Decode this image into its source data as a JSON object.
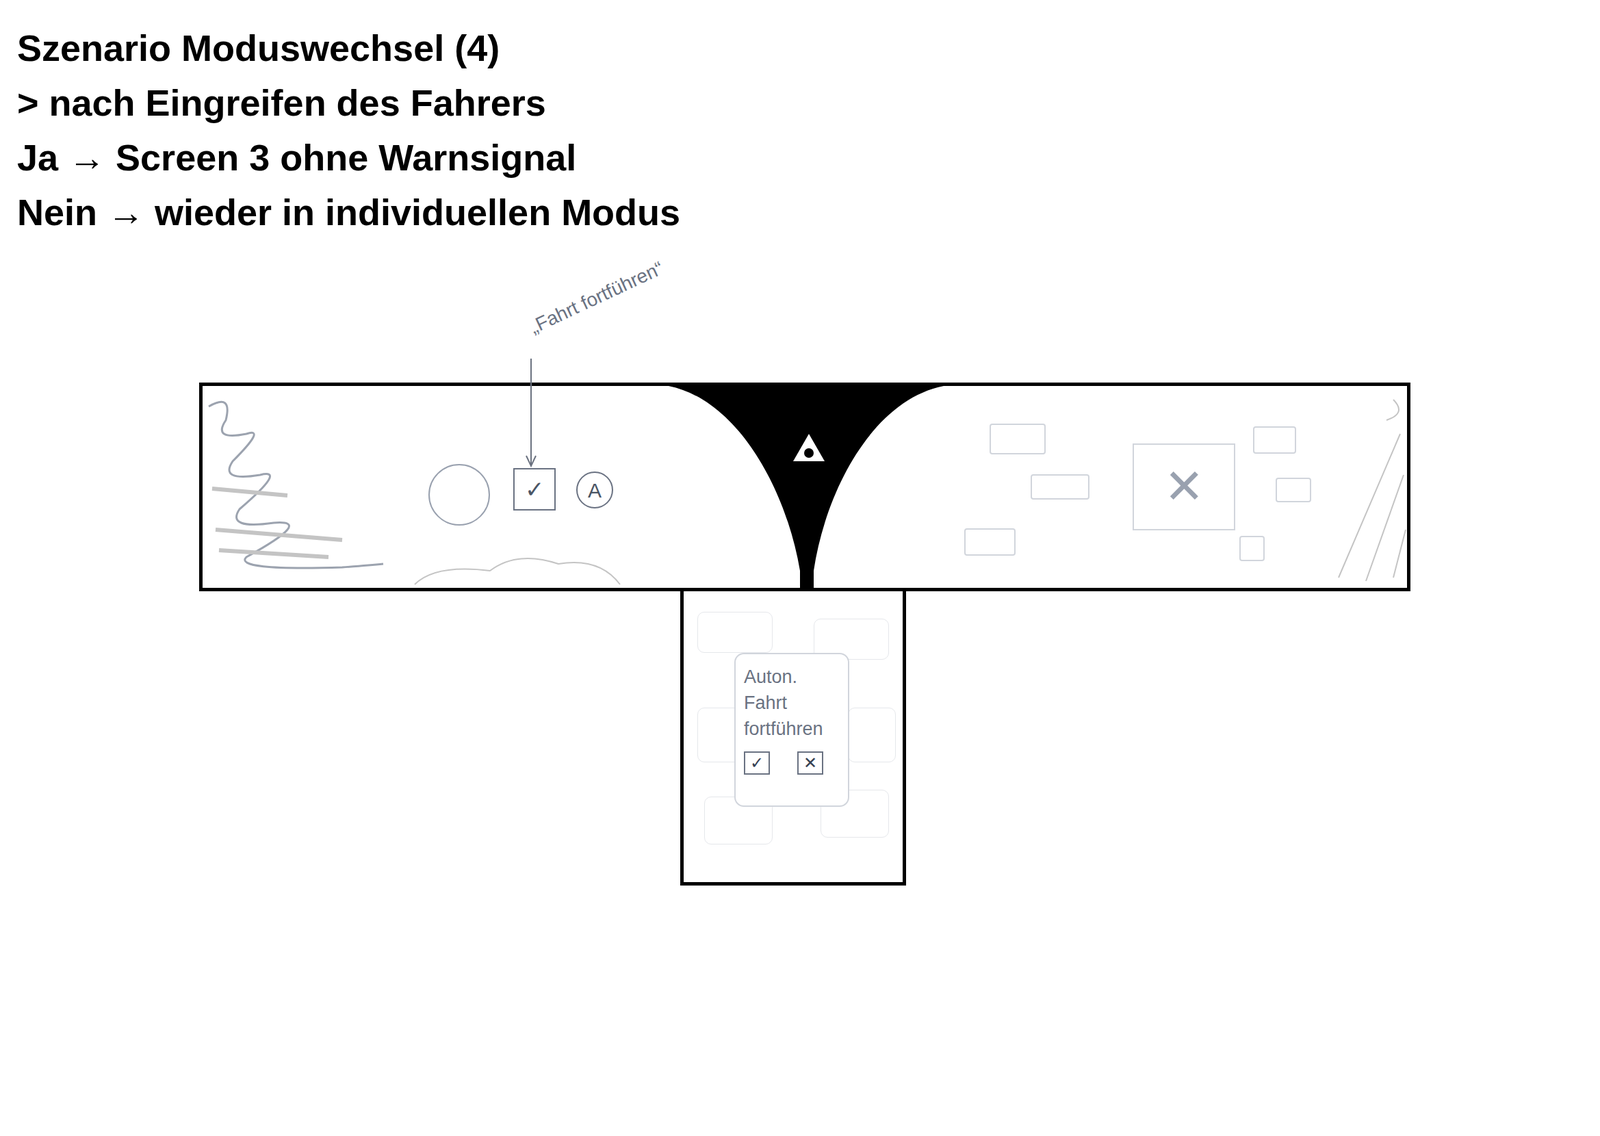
{
  "header": {
    "title": "Szenario Moduswechsel (4)",
    "lines": [
      "> nach Eingreifen des Fahrers",
      "Ja → Screen 3 ohne Warnsignal",
      "Nein → wieder in individuellen Modus"
    ]
  },
  "main_screen": {
    "annotation": "„Fahrt fortführen“",
    "confirm_icon": "✓",
    "mode_badge": "A",
    "cancel_icon": "✕"
  },
  "dialog": {
    "text": "Auton. Fahrt fortführen",
    "buttons": [
      "✓",
      "✕"
    ]
  }
}
